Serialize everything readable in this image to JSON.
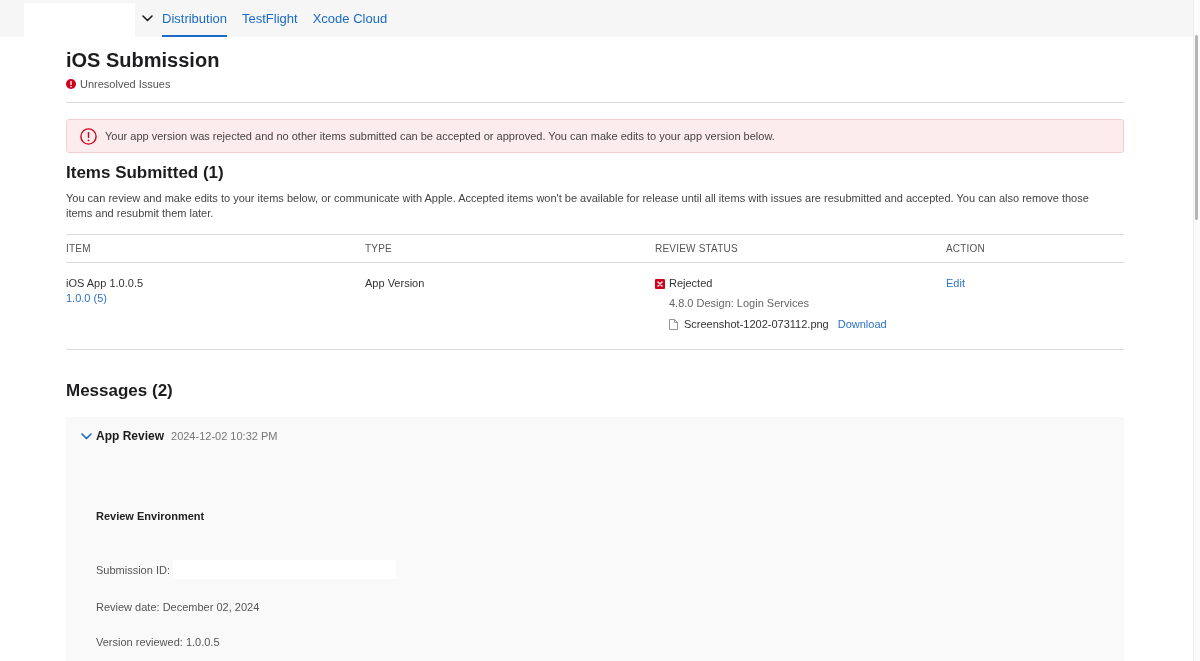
{
  "nav": {
    "tabs": [
      {
        "label": "Distribution",
        "selected": true
      },
      {
        "label": "TestFlight",
        "selected": false
      },
      {
        "label": "Xcode Cloud",
        "selected": false
      }
    ]
  },
  "header": {
    "title": "iOS Submission",
    "status": "Unresolved Issues"
  },
  "alert": {
    "message": "Your app version was rejected and no other items submitted can be accepted or approved. You can make edits to your app version below."
  },
  "items_submitted": {
    "title": "Items Submitted (1)",
    "description": "You can review and make edits to your items below, or communicate with Apple. Accepted items won't be available for release until all items with issues are resubmitted and accepted. You can also remove those items and resubmit them later.",
    "table": {
      "columns": [
        "ITEM",
        "TYPE",
        "REVIEW STATUS",
        "ACTION"
      ],
      "rows": [
        {
          "item": "iOS App 1.0.0.5",
          "build": "1.0.0 (5)",
          "type": "App Version",
          "status": "Rejected",
          "reason": "4.8.0 Design: Login Services",
          "attachment": "Screenshot-1202-073112.png",
          "download": "Download",
          "action": "Edit"
        }
      ]
    }
  },
  "messages": {
    "title": "Messages (2)",
    "items": [
      {
        "sender": "App Review",
        "time": "2024-12-02 10:32 PM",
        "expanded": true,
        "section": "Review Environment",
        "fields": [
          {
            "text": "Submission ID:",
            "redacted": true
          },
          {
            "text": "Review date: December 02, 2024",
            "redacted": false
          },
          {
            "text": "Version reviewed: 1.0.0.5",
            "redacted": false
          }
        ]
      }
    ]
  }
}
